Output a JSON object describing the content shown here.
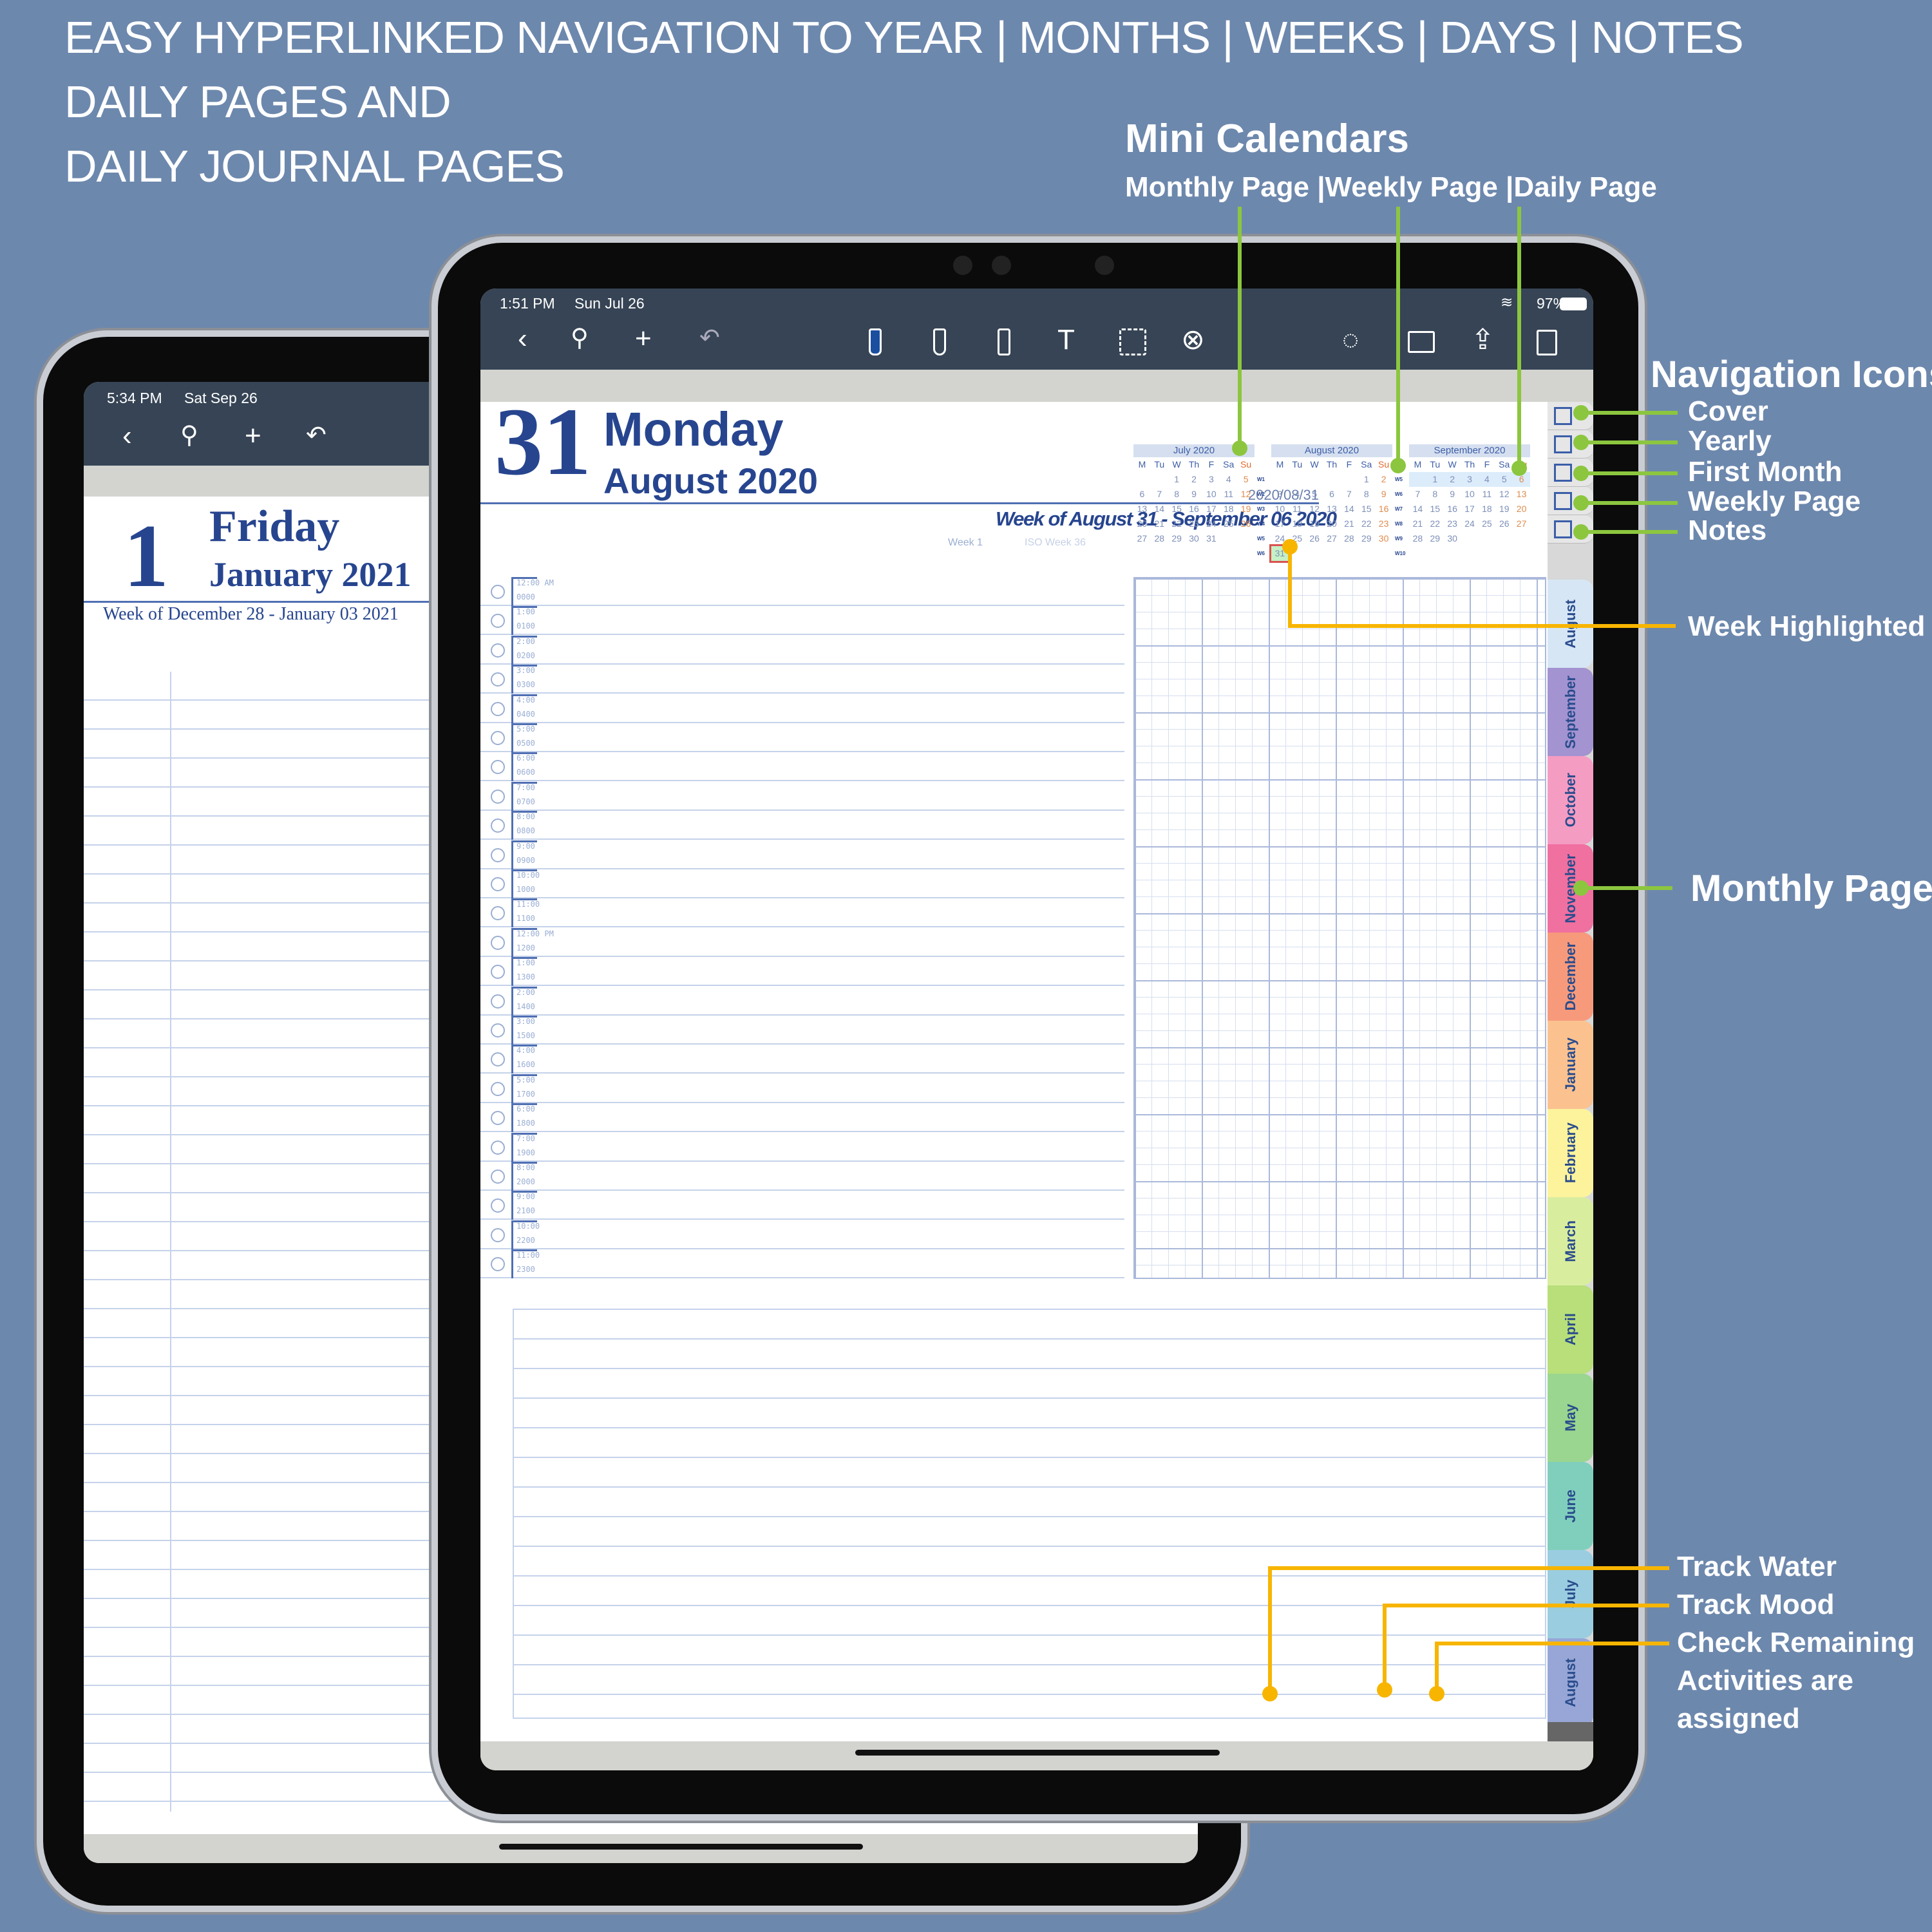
{
  "headline": [
    "Easy hyperlinked navigation to Year | Months | Weeks | Days | Notes",
    "Daily pages and",
    "Daily journal pages"
  ],
  "back_tablet": {
    "time": "5:34 PM",
    "date": "Sat Sep 26",
    "day_number": "1",
    "weekday": "Friday",
    "month_year": "January 2021",
    "week_of": "Week of December 28 - January 03 2021"
  },
  "front_tablet": {
    "time": "1:51 PM",
    "date": "Sun Jul 26",
    "battery": "97%",
    "day_number": "31",
    "weekday": "Monday",
    "month_year": "August 2020",
    "date_iso": "2020/08/31",
    "week_of": "Week of August 31 - September 06 2020",
    "week_label": "Week  1",
    "iso_week": "ISO Week  36",
    "hours": [
      {
        "label": "12:00 AM",
        "mil": "0000"
      },
      {
        "label": "1:00",
        "mil": "0100"
      },
      {
        "label": "2:00",
        "mil": "0200"
      },
      {
        "label": "3:00",
        "mil": "0300"
      },
      {
        "label": "4:00",
        "mil": "0400"
      },
      {
        "label": "5:00",
        "mil": "0500"
      },
      {
        "label": "6:00",
        "mil": "0600"
      },
      {
        "label": "7:00",
        "mil": "0700"
      },
      {
        "label": "8:00",
        "mil": "0800"
      },
      {
        "label": "9:00",
        "mil": "0900"
      },
      {
        "label": "10:00",
        "mil": "1000"
      },
      {
        "label": "11:00",
        "mil": "1100"
      },
      {
        "label": "12:00 PM",
        "mil": "1200"
      },
      {
        "label": "1:00",
        "mil": "1300"
      },
      {
        "label": "2:00",
        "mil": "1400"
      },
      {
        "label": "3:00",
        "mil": "1500"
      },
      {
        "label": "4:00",
        "mil": "1600"
      },
      {
        "label": "5:00",
        "mil": "1700"
      },
      {
        "label": "6:00",
        "mil": "1800"
      },
      {
        "label": "7:00",
        "mil": "1900"
      },
      {
        "label": "8:00",
        "mil": "2000"
      },
      {
        "label": "9:00",
        "mil": "2100"
      },
      {
        "label": "10:00",
        "mil": "2200"
      },
      {
        "label": "11:00",
        "mil": "2300"
      }
    ],
    "mini_calendars": [
      {
        "title": "July 2020",
        "dow": [
          "M",
          "Tu",
          "W",
          "Th",
          "F",
          "Sa",
          "Su"
        ],
        "weeks": [
          [
            "",
            "",
            "1",
            "2",
            "3",
            "4",
            "5"
          ],
          [
            "6",
            "7",
            "8",
            "9",
            "10",
            "11",
            "12"
          ],
          [
            "13",
            "14",
            "15",
            "16",
            "17",
            "18",
            "19"
          ],
          [
            "20",
            "21",
            "22",
            "23",
            "24",
            "25",
            "26"
          ],
          [
            "27",
            "28",
            "29",
            "30",
            "31",
            "",
            ""
          ]
        ],
        "week_numbers": [
          "W1",
          "W2",
          "W3",
          "W4",
          "W5",
          "W6"
        ]
      },
      {
        "title": "August 2020",
        "dow": [
          "M",
          "Tu",
          "W",
          "Th",
          "F",
          "Sa",
          "Su"
        ],
        "weeks": [
          [
            "",
            "",
            "",
            "",
            "",
            "1",
            "2"
          ],
          [
            "3",
            "4",
            "5",
            "6",
            "7",
            "8",
            "9"
          ],
          [
            "10",
            "11",
            "12",
            "13",
            "14",
            "15",
            "16"
          ],
          [
            "17",
            "18",
            "19",
            "20",
            "21",
            "22",
            "23"
          ],
          [
            "24",
            "25",
            "26",
            "27",
            "28",
            "29",
            "30"
          ],
          [
            "31",
            "",
            "",
            "",
            "",
            "",
            ""
          ]
        ],
        "week_numbers": [
          "W5",
          "W6",
          "W7",
          "W8",
          "W9",
          "W10"
        ],
        "today": "31"
      },
      {
        "title": "September 2020",
        "dow": [
          "M",
          "Tu",
          "W",
          "Th",
          "F",
          "Sa",
          "Su"
        ],
        "weeks": [
          [
            "",
            "1",
            "2",
            "3",
            "4",
            "5",
            "6"
          ],
          [
            "7",
            "8",
            "9",
            "10",
            "11",
            "12",
            "13"
          ],
          [
            "14",
            "15",
            "16",
            "17",
            "18",
            "19",
            "20"
          ],
          [
            "21",
            "22",
            "23",
            "24",
            "25",
            "26",
            "27"
          ],
          [
            "28",
            "29",
            "30",
            "",
            "",
            "",
            ""
          ]
        ],
        "highlighted_week": 0
      }
    ],
    "nav_icons": [
      "cover-icon",
      "yearly-icon",
      "first-month-icon",
      "weekly-page-icon",
      "notes-icon"
    ],
    "month_tabs": [
      {
        "label": "August",
        "color": "#d6e6f5"
      },
      {
        "label": "September",
        "color": "#a393d1"
      },
      {
        "label": "October",
        "color": "#f59cc3"
      },
      {
        "label": "November",
        "color": "#f0709f"
      },
      {
        "label": "December",
        "color": "#f79a7c"
      },
      {
        "label": "January",
        "color": "#fbc290"
      },
      {
        "label": "February",
        "color": "#fcf39c"
      },
      {
        "label": "March",
        "color": "#d9ed9f"
      },
      {
        "label": "April",
        "color": "#b8df7a"
      },
      {
        "label": "May",
        "color": "#9ad68f"
      },
      {
        "label": "June",
        "color": "#80cfbd"
      },
      {
        "label": "July",
        "color": "#9acde0"
      },
      {
        "label": "August",
        "color": "#97a6d6"
      }
    ]
  },
  "annotations": {
    "mini_calendars": "Mini Calendars",
    "mini_calendars_sub": "Monthly Page  |Weekly Page  |Daily Page",
    "navigation_icons": "Navigation Icons",
    "nav_labels": [
      "Cover",
      "Yearly",
      "First Month",
      "Weekly Page",
      "Notes"
    ],
    "week_highlighted": "Week Highlighted",
    "monthly_page": "Monthly Page",
    "trackers": [
      "Track Water",
      "Track Mood",
      "Check Remaining",
      "Activities are",
      "assigned"
    ]
  },
  "colors": {
    "background": "#6d88ad",
    "toolbar": "#364455",
    "accent_blue": "#27458f",
    "green_callout": "#8cc63f",
    "yellow_callout": "#f7b500"
  }
}
